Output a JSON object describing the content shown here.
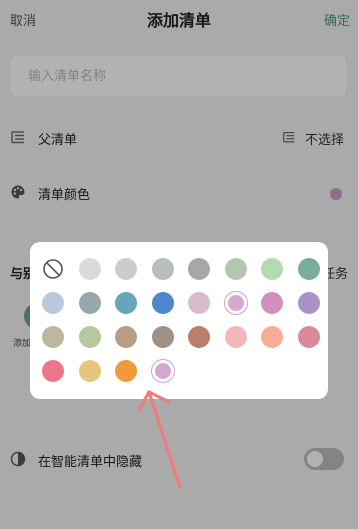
{
  "header": {
    "cancel_label": "取消",
    "title": "添加清单",
    "confirm_label": "确定"
  },
  "name_input": {
    "placeholder": "输入清单名称",
    "value": ""
  },
  "parent_list": {
    "label": "父清单",
    "value": "不选择",
    "icon": "list-indent-icon"
  },
  "list_color": {
    "label": "清单颜色",
    "icon": "palette-icon",
    "current_color": "#c9a1c9"
  },
  "share": {
    "label": "与别",
    "right_text": "任务",
    "member_label": "添加"
  },
  "hide_smart": {
    "label": "在智能清单中隐藏",
    "icon": "moon-icon",
    "enabled": false
  },
  "color_picker": {
    "none_icon": "no-color-icon",
    "colors": [
      "#dadada",
      "#cccccc",
      "#b8bdbd",
      "#a5a8a8",
      "#b4c7b0",
      "#b3dbb1",
      "#7aae98",
      "#b9cbdb",
      "#96a8ae",
      "#66a6b8",
      "#4b87c9",
      "#dbbacb",
      "#d4a8cf",
      "#d290c1",
      "#a993c4",
      "#bdb7a0",
      "#b7c79e",
      "#b79d86",
      "#a09184",
      "#b8806c",
      "#f2b7bb",
      "#f8ab95",
      "#d98b99",
      "#ec7685",
      "#e4c67f",
      "#f09a3d",
      "#d4a8cf"
    ],
    "selected_index_in_row2": 5,
    "selected_index_in_row4": 3
  },
  "annotation": {
    "type": "arrow",
    "color": "#f07a80"
  }
}
